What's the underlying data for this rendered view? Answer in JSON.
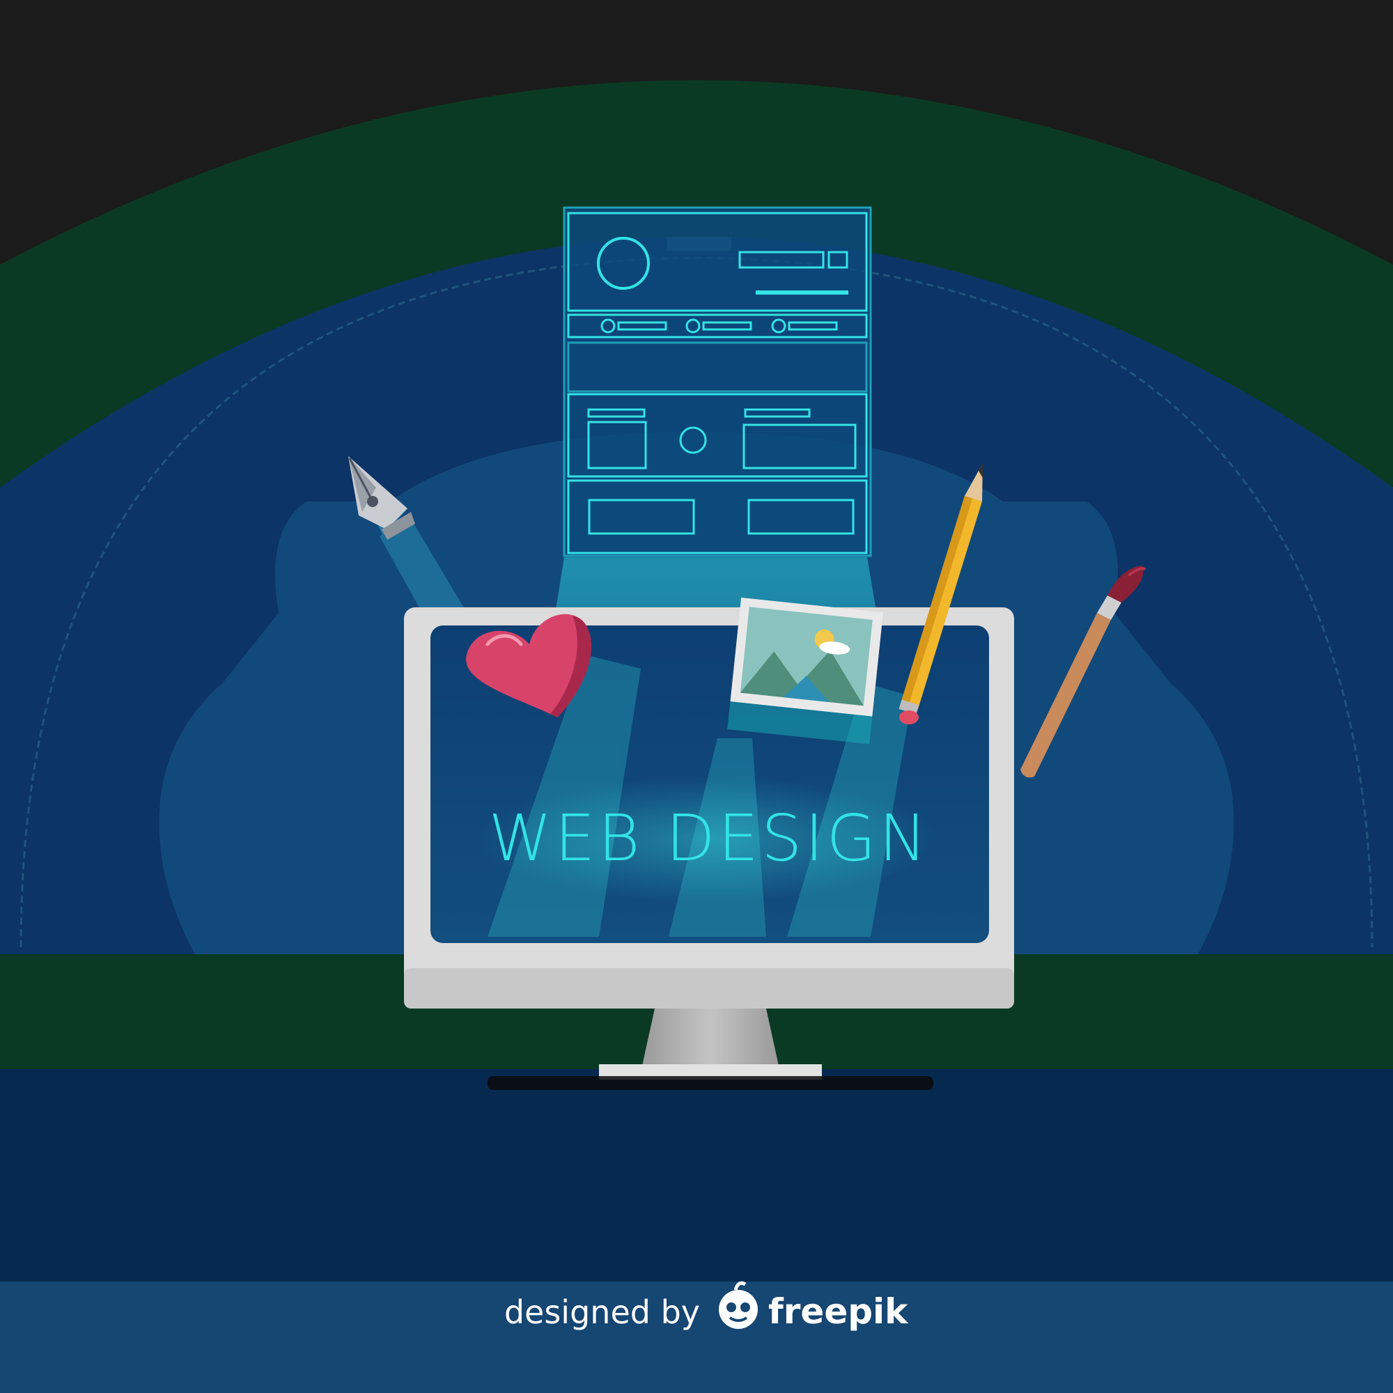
{
  "headline": "WEB DESIGN",
  "credit": {
    "prefix": "designed by",
    "brand": "freepik"
  },
  "icons": [
    "wireframe-icon",
    "fountain-pen-icon",
    "heart-icon",
    "photo-icon",
    "pencil-icon",
    "paintbrush-icon",
    "freepik-logo-icon"
  ],
  "colors": {
    "background_dark": "#1b1b1b",
    "dome_green": "#0b3a24",
    "dome_blue": "#0c3466",
    "floor_navy": "#06294f",
    "footer_blue": "#164672",
    "neon_cyan": "#33e3e6",
    "monitor_frame": "#dcdcdc",
    "heart_pink": "#d8436a",
    "pencil_yellow": "#f2b72b"
  }
}
